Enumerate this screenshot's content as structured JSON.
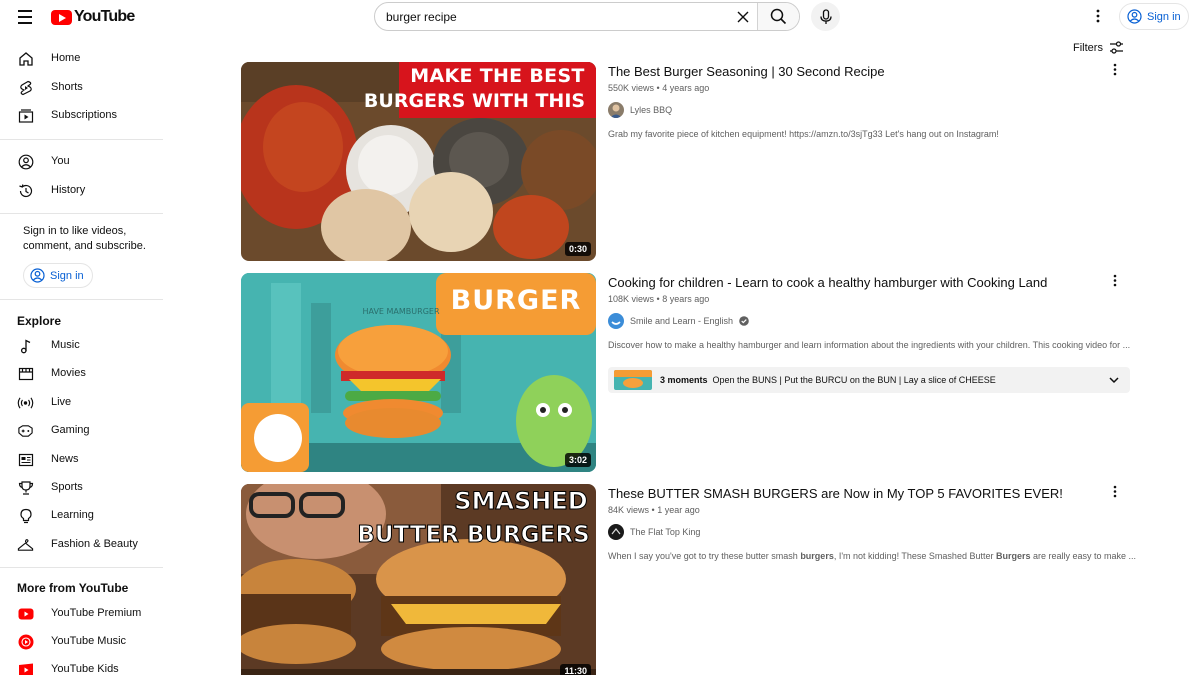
{
  "header": {
    "logo_text": "YouTube",
    "search_value": "burger recipe",
    "signin_label": "Sign in"
  },
  "sidebar": {
    "main": [
      {
        "label": "Home",
        "icon": "home-icon"
      },
      {
        "label": "Shorts",
        "icon": "shorts-icon"
      },
      {
        "label": "Subscriptions",
        "icon": "subscriptions-icon"
      }
    ],
    "you": [
      {
        "label": "You",
        "icon": "you-icon"
      },
      {
        "label": "History",
        "icon": "history-icon"
      }
    ],
    "signin_note": "Sign in to like videos, comment, and subscribe.",
    "signin_label": "Sign in",
    "explore_title": "Explore",
    "explore": [
      {
        "label": "Music",
        "icon": "music-icon"
      },
      {
        "label": "Movies",
        "icon": "movies-icon"
      },
      {
        "label": "Live",
        "icon": "live-icon"
      },
      {
        "label": "Gaming",
        "icon": "gaming-icon"
      },
      {
        "label": "News",
        "icon": "news-icon"
      },
      {
        "label": "Sports",
        "icon": "sports-icon"
      },
      {
        "label": "Learning",
        "icon": "learning-icon"
      },
      {
        "label": "Fashion & Beauty",
        "icon": "fashion-icon"
      }
    ],
    "more_title": "More from YouTube",
    "more": [
      {
        "label": "YouTube Premium",
        "icon": "youtube-premium-icon"
      },
      {
        "label": "YouTube Music",
        "icon": "youtube-music-icon"
      },
      {
        "label": "YouTube Kids",
        "icon": "youtube-kids-icon"
      }
    ]
  },
  "filters_label": "Filters",
  "results": [
    {
      "title": "The Best Burger Seasoning | 30 Second Recipe",
      "views": "550K views",
      "age": "4 years ago",
      "channel": "Lyles BBQ",
      "description": "Grab my favorite piece of kitchen equipment! https://amzn.to/3sjTg33 Let's hang out on Instagram!",
      "duration": "0:30",
      "thumb_text_1": "MAKE THE BEST",
      "thumb_text_2": "BURGERS WITH THIS"
    },
    {
      "title": "Cooking for children - Learn to cook a healthy hamburger with Cooking Land",
      "views": "108K views",
      "age": "8 years ago",
      "channel": "Smile and Learn - English",
      "verified": true,
      "description": "Discover how to make a healthy hamburger and learn information about the ingredients with your children. This cooking video for ...",
      "duration": "3:02",
      "thumb_text_1": "BURGER",
      "thumb_text_2": "HAVE MAMBURGER",
      "moments_count": "3 moments",
      "moments_text": "Open the BUNS | Put the BURCU on the BUN | Lay a slice of CHEESE"
    },
    {
      "title": "These BUTTER SMASH BURGERS are Now in My TOP 5 FAVORITES EVER!",
      "views": "84K views",
      "age": "1 year ago",
      "channel": "The Flat Top King",
      "description_parts": [
        "When I say you've got to try these butter smash ",
        "burgers",
        ", I'm not kidding! These Smashed Butter ",
        "Burgers",
        " are really easy to make ..."
      ],
      "duration": "11:30",
      "thumb_text_1": "SMASHED",
      "thumb_text_2": "BUTTER BURGERS"
    }
  ],
  "colors": {
    "brand_red": "#ff0000",
    "link_blue": "#065fd4",
    "text_primary": "#0f0f0f",
    "text_secondary": "#606060"
  }
}
